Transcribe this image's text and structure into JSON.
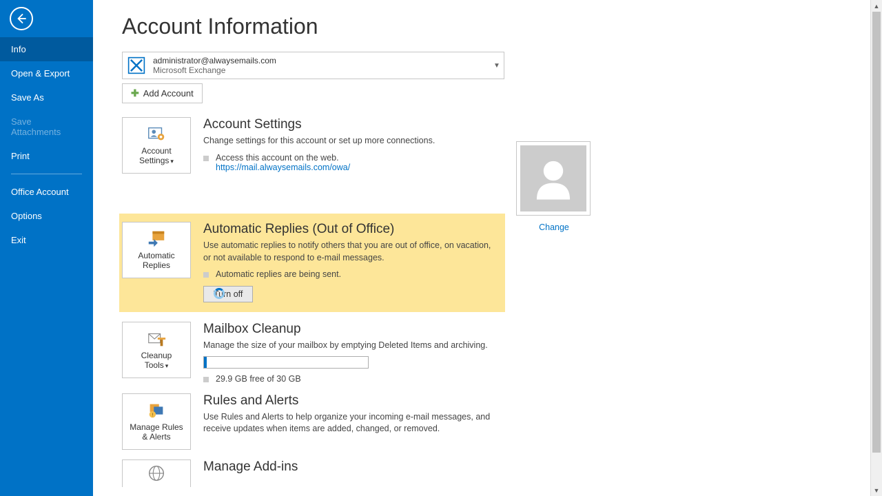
{
  "sidebar": {
    "items": [
      {
        "label": "Info",
        "selected": true
      },
      {
        "label": "Open & Export"
      },
      {
        "label": "Save As"
      },
      {
        "label": "Save Attachments",
        "disabled": true
      },
      {
        "label": "Print"
      }
    ],
    "items2": [
      {
        "label": "Office Account"
      },
      {
        "label": "Options"
      },
      {
        "label": "Exit"
      }
    ]
  },
  "page_title": "Account Information",
  "account": {
    "email": "administrator@alwaysemails.com",
    "type": "Microsoft Exchange",
    "add_button": "Add Account"
  },
  "avatar": {
    "change": "Change"
  },
  "sections": {
    "settings": {
      "tile": "Account\nSettings",
      "title": "Account Settings",
      "desc": "Change settings for this account or set up more connections.",
      "bullet": "Access this account on the web.",
      "link": "https://mail.alwaysemails.com/owa/"
    },
    "autoreply": {
      "tile": "Automatic\nReplies",
      "title": "Automatic Replies (Out of Office)",
      "desc": "Use automatic replies to notify others that you are out of office, on vacation, or not available to respond to e-mail messages.",
      "bullet": "Automatic replies are being sent.",
      "button": "Turn off"
    },
    "cleanup": {
      "tile": "Cleanup\nTools",
      "title": "Mailbox Cleanup",
      "desc": "Manage the size of your mailbox by emptying Deleted Items and archiving.",
      "storage": "29.9 GB free of 30 GB"
    },
    "rules": {
      "tile": "Manage Rules\n& Alerts",
      "title": "Rules and Alerts",
      "desc": "Use Rules and Alerts to help organize your incoming e-mail messages, and receive updates when items are added, changed, or removed."
    },
    "addins": {
      "title": "Manage Add-ins"
    }
  }
}
